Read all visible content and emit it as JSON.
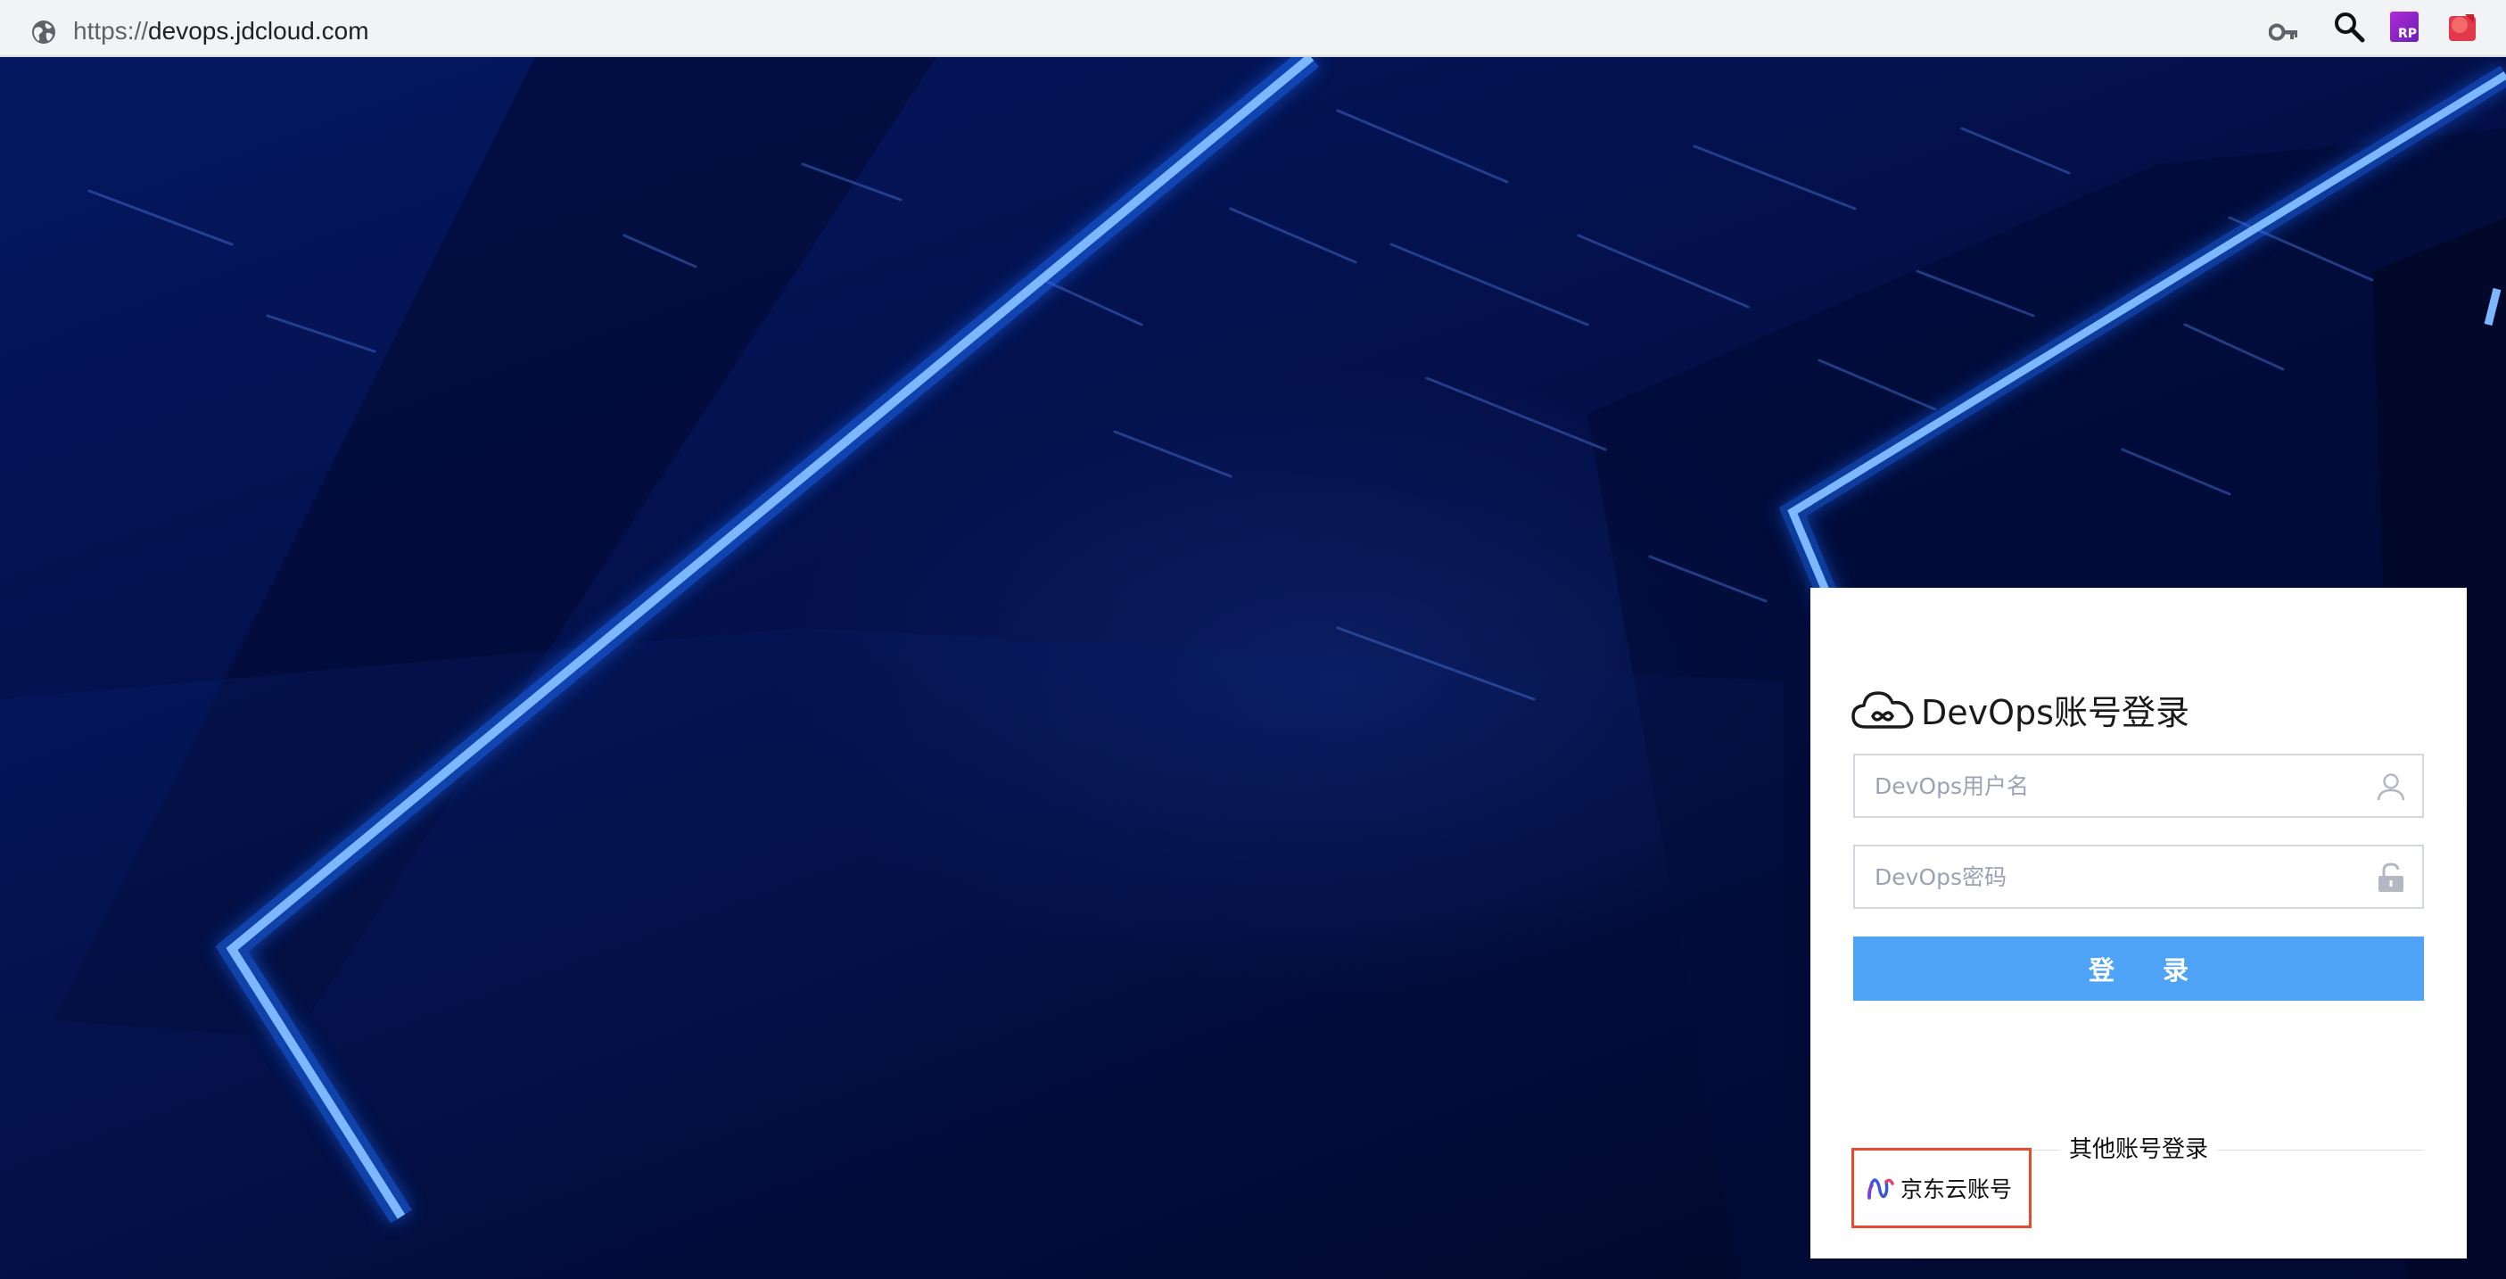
{
  "browser": {
    "url_scheme": "https://",
    "url_host": "devops.jdcloud.com",
    "icons": [
      "globe-icon",
      "key-icon",
      "search-icon",
      "rp-extension-icon",
      "red-extension-icon"
    ],
    "rp_badge": "RP"
  },
  "login": {
    "title": "DevOps账号登录",
    "username_placeholder": "DevOps用户名",
    "password_placeholder": "DevOps密码",
    "submit_label": "登 录",
    "other_login_label": "其他账号登录",
    "jd_cloud_label": "京东云账号"
  },
  "colors": {
    "button_blue": "#4ea3f7",
    "highlight_red": "#e54b2c",
    "background_navy": "#03114d",
    "neon_blue": "#3d8bff"
  }
}
